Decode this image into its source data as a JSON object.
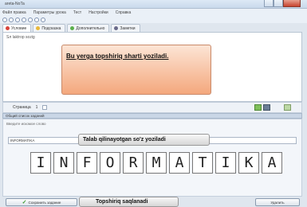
{
  "window": {
    "title": "areta-NoTa"
  },
  "menubar": {
    "items": [
      "Файл правка",
      "Параметры урока",
      "Тест",
      "Настройки",
      "Справка"
    ]
  },
  "tabs": [
    {
      "label": "Условие",
      "color": "#d9423a"
    },
    {
      "label": "Подсказка",
      "color": "#e9b83a"
    },
    {
      "label": "Дополнительно",
      "color": "#5ab04a"
    },
    {
      "label": "Заметки",
      "color": "#6a6a8a"
    }
  ],
  "editor": {
    "line1": "Sл laktrop sozig"
  },
  "callouts": {
    "task": "Bu yerga topshiriq sharti yoziladi.",
    "word": "Talab qilinayotgan so'z yoziladi",
    "save": "Topshiriq saqlanadi"
  },
  "statusbar": {
    "page_label": "Страница",
    "page_value": "1"
  },
  "panel": {
    "header": "Общий список заданий",
    "subtitle": "Введите искомое слово",
    "answer_value": "INFORMATIKA"
  },
  "letters": [
    "I",
    "N",
    "F",
    "O",
    "R",
    "M",
    "A",
    "T",
    "I",
    "K",
    "A"
  ],
  "buttons": {
    "save": "Сохранить задание",
    "right": "Удалить"
  }
}
